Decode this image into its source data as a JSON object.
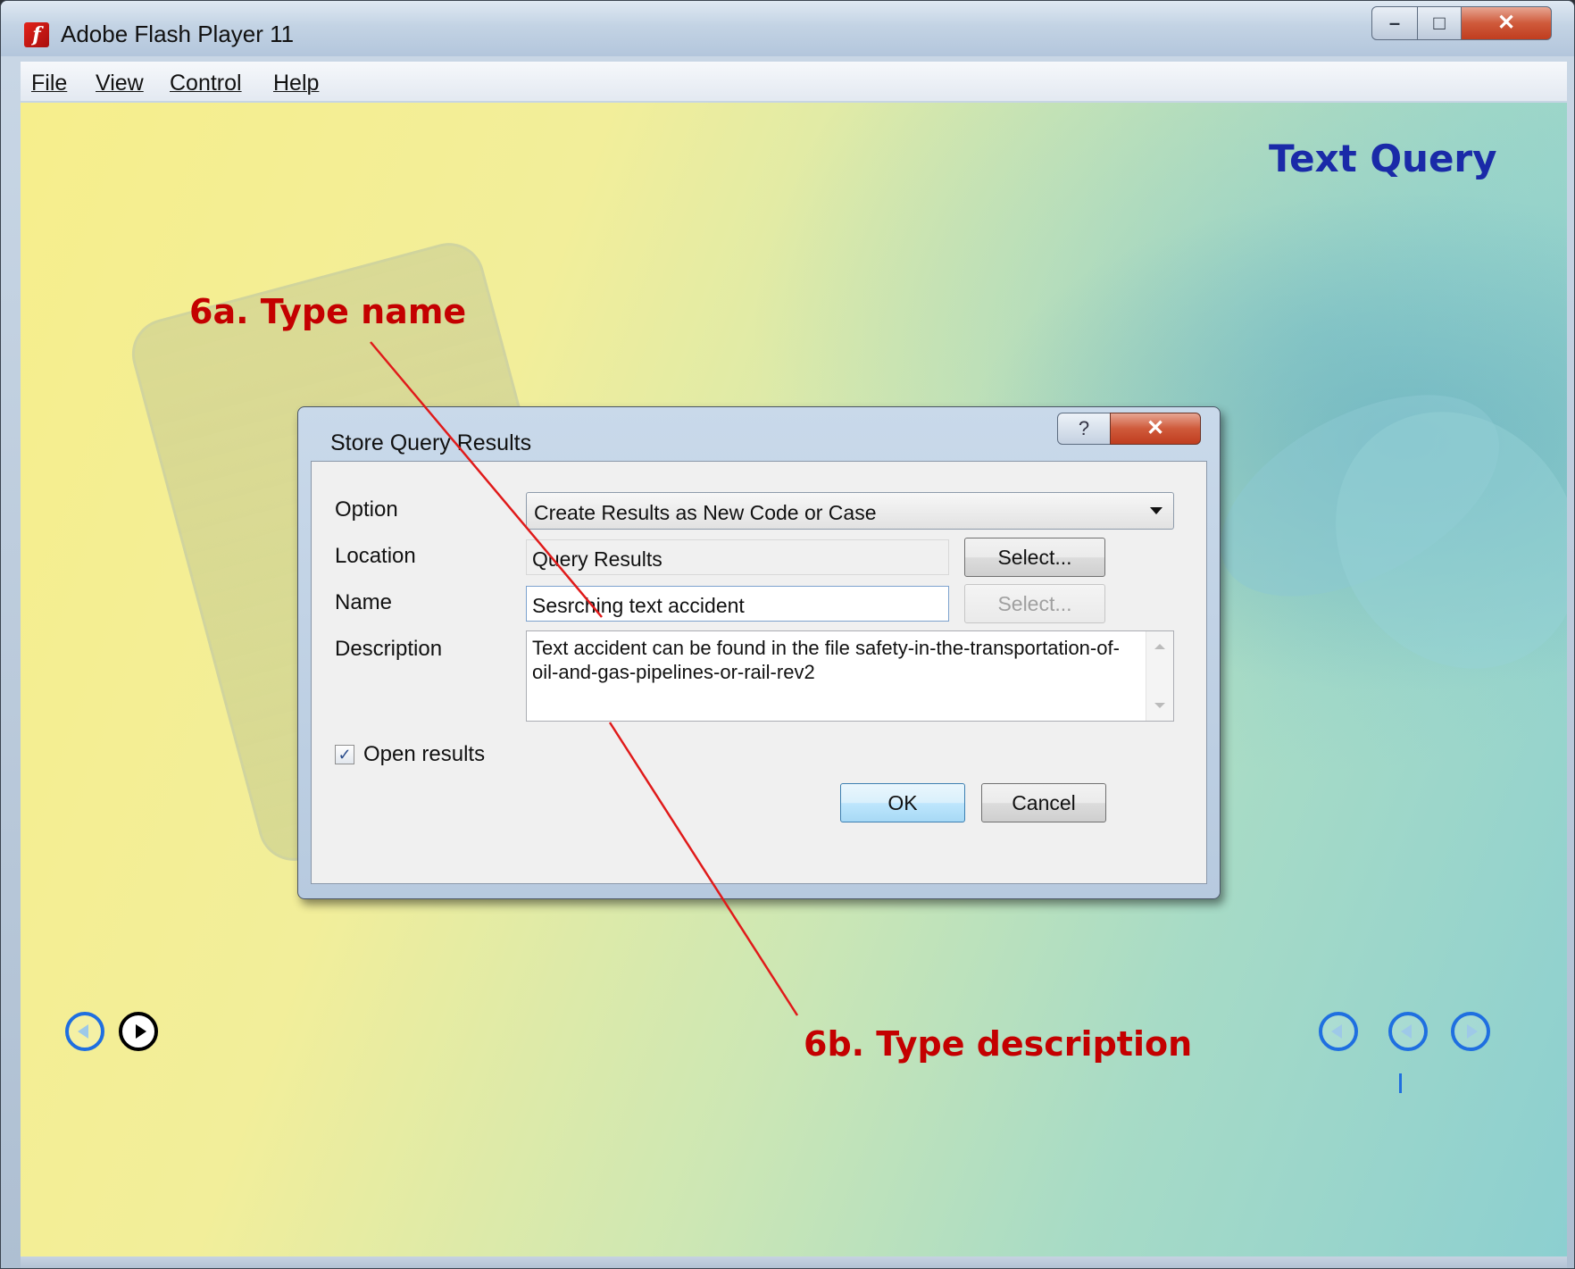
{
  "window": {
    "title": "Adobe Flash Player 11",
    "app_icon": "flash-f-icon",
    "controls": {
      "minimize_glyph": "–",
      "maximize_glyph": "□",
      "close_glyph": "✕"
    }
  },
  "menu": {
    "items": [
      {
        "label": "File"
      },
      {
        "label": "View"
      },
      {
        "label": "Control"
      },
      {
        "label": "Help"
      }
    ]
  },
  "slide": {
    "title": "Text Query",
    "callouts": {
      "name": "6a. Type name",
      "description": "6b. Type description"
    },
    "callout_color": "#c40000",
    "title_color": "#1a2aa8"
  },
  "dialog": {
    "title": "Store Query Results",
    "help_glyph": "?",
    "close_glyph": "✕",
    "option": {
      "label": "Option",
      "value": "Create Results as New Code or Case"
    },
    "location": {
      "label": "Location",
      "value": "Query Results",
      "button": "Select..."
    },
    "name": {
      "label": "Name",
      "value": "Sesrching text accident",
      "button": "Select..."
    },
    "description": {
      "label": "Description",
      "value": "Text accident  can be found in the file safety-in-the-transportation-of-oil-and-gas-pipelines-or-rail-rev2"
    },
    "open_results": {
      "label": "Open results",
      "checked": true
    },
    "ok": "OK",
    "cancel": "Cancel"
  },
  "nav": {
    "accent": "#1f6fe0",
    "icons": [
      "back-icon",
      "play-icon",
      "first-icon",
      "previous-icon",
      "next-icon"
    ]
  }
}
